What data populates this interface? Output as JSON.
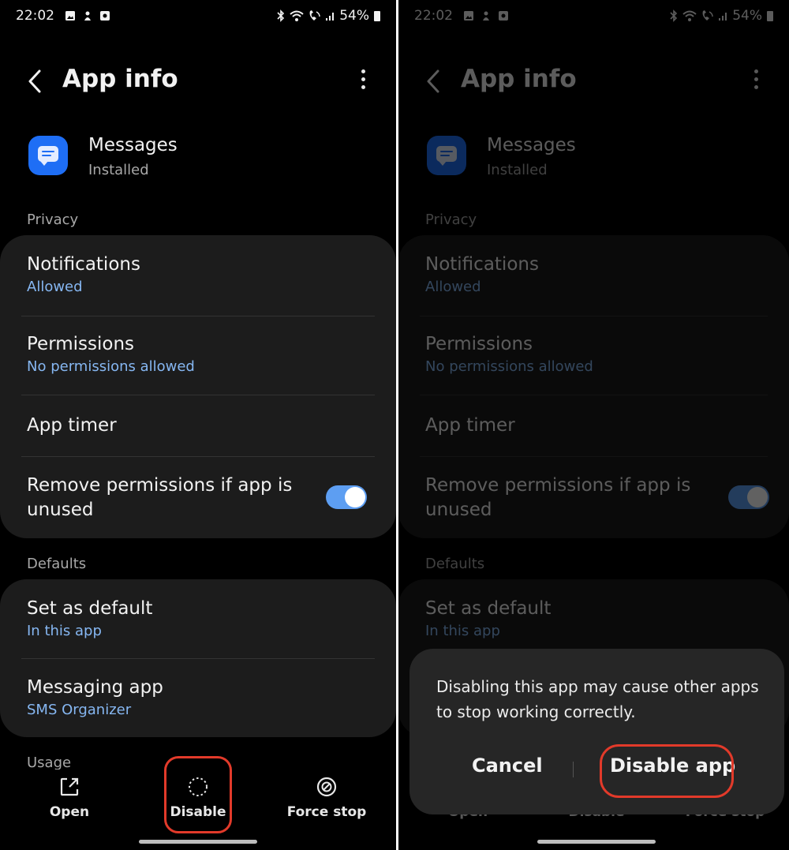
{
  "status_bar": {
    "time": "22:02",
    "battery": "54%"
  },
  "header": {
    "title": "App info"
  },
  "app": {
    "name": "Messages",
    "status": "Installed"
  },
  "sections": {
    "privacy": "Privacy",
    "defaults": "Defaults",
    "usage": "Usage"
  },
  "privacy_items": {
    "notifications": {
      "label": "Notifications",
      "value": "Allowed"
    },
    "permissions": {
      "label": "Permissions",
      "value": "No permissions allowed"
    },
    "app_timer": {
      "label": "App timer"
    },
    "remove_permissions": {
      "label": "Remove permissions if app is unused",
      "enabled": true
    }
  },
  "default_items": {
    "set_default": {
      "label": "Set as default",
      "value": "In this app"
    },
    "messaging_app": {
      "label": "Messaging app",
      "value": "SMS Organizer"
    }
  },
  "bottom_bar": {
    "open": "Open",
    "disable": "Disable",
    "force_stop": "Force stop"
  },
  "dialog": {
    "message": "Disabling this app may cause other apps to stop working correctly.",
    "cancel": "Cancel",
    "confirm": "Disable app"
  },
  "colors": {
    "background": "#000000",
    "card": "#1c1c1c",
    "accent_blue": "#86b7f2",
    "toggle_on": "#5d9ef2",
    "highlight": "#e23a2a",
    "app_icon": "#1e6ef5"
  }
}
